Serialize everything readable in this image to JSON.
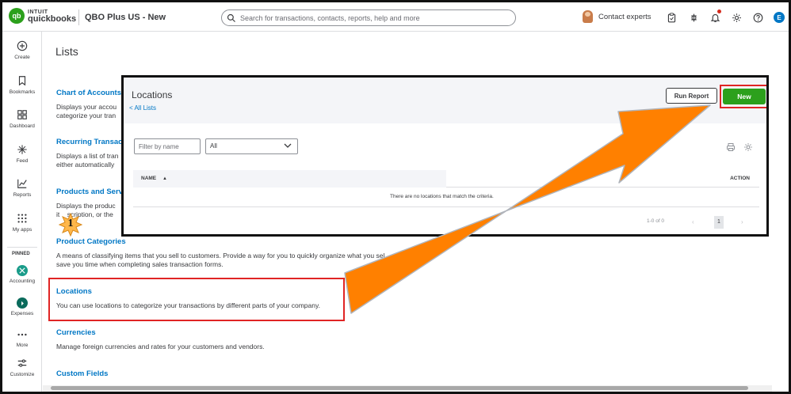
{
  "header": {
    "logo_mark": "qb",
    "logo_line1": "INTUIT",
    "logo_line2": "quickbooks",
    "company": "QBO Plus US - New",
    "search_placeholder": "Search for transactions, contacts, reports, help and more",
    "contact_label": "Contact experts",
    "user_initial": "E",
    "icons": [
      "search-icon",
      "clipboard-icon",
      "apps-icon",
      "bell-icon",
      "gear-icon",
      "help-icon"
    ]
  },
  "leftnav": {
    "items": [
      {
        "label": "Create",
        "icon": "plus-circle-icon"
      },
      {
        "label": "Bookmarks",
        "icon": "bookmark-icon"
      },
      {
        "label": "Dashboard",
        "icon": "dashboard-icon"
      },
      {
        "label": "Feed",
        "icon": "sparkle-icon"
      },
      {
        "label": "Reports",
        "icon": "chart-line-icon"
      },
      {
        "label": "My apps",
        "icon": "grid-dots-icon"
      }
    ],
    "pinned_label": "PINNED",
    "pinned": [
      {
        "label": "Accounting",
        "color": "#1a9c8a"
      },
      {
        "label": "Expenses",
        "color": "#0a6b5c"
      }
    ],
    "more_label": "More",
    "customize_label": "Customize"
  },
  "page": {
    "title": "Lists",
    "lists": [
      {
        "title": "Chart of Accounts",
        "desc1": "Displays your accou",
        "desc2": "categorize your tran"
      },
      {
        "title": "Recurring Transac",
        "desc1": "Displays a list of tran",
        "desc2": "either automatically"
      },
      {
        "title": "Products and Serv",
        "desc1": "Displays the produc",
        "desc2": "it    scription, or the"
      },
      {
        "title": "Product Categories",
        "desc1": "A means of classifying items that you sell to customers. Provide a way for you to quickly organize what you sel",
        "desc2": "save you time when completing sales transaction forms."
      },
      {
        "title": "Locations",
        "desc1": "You can use locations to categorize your transactions by different parts of your company.",
        "desc2": ""
      },
      {
        "title": "Currencies",
        "desc1": "Manage foreign currencies and rates for your customers and vendors.",
        "desc2": ""
      },
      {
        "title": "Custom Fields",
        "desc1": "",
        "desc2": ""
      }
    ]
  },
  "modal": {
    "title": "Locations",
    "back_link": "< All Lists",
    "run_report": "Run Report",
    "new_button": "New",
    "filter_placeholder": "Filter by name",
    "select_value": "All",
    "col_name": "NAME",
    "col_action": "ACTION",
    "empty_message": "There are no locations that match the criteria.",
    "pager_text": "1-0 of 0",
    "current_page": "1"
  },
  "annotation": {
    "step_number": "1",
    "highlight_color": "#e02424",
    "arrow_color": "#ff8000"
  }
}
